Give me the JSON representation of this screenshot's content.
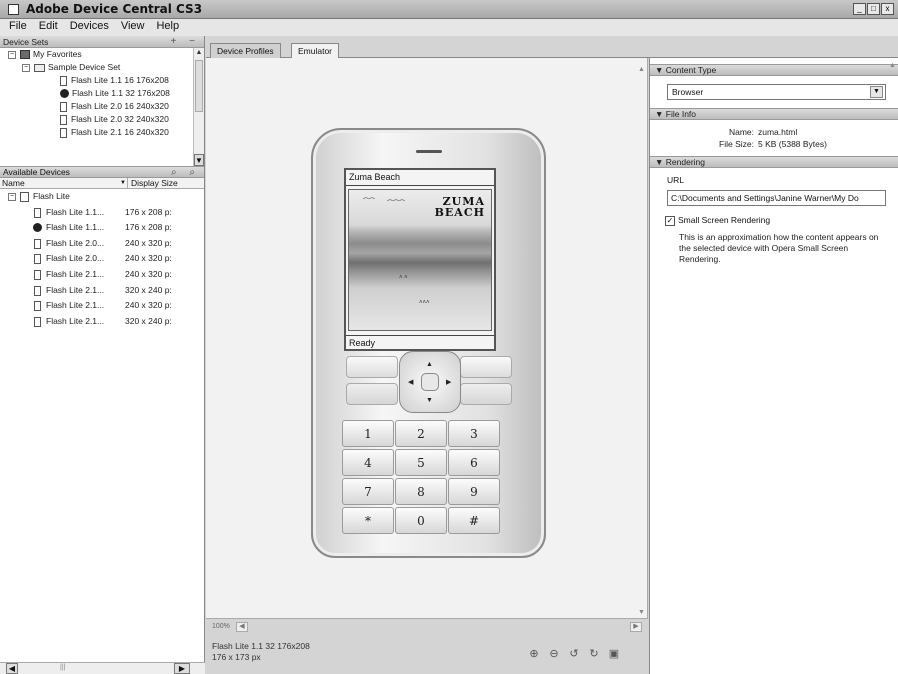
{
  "window": {
    "title": "Adobe Device Central CS3",
    "buttons": [
      "_",
      "□",
      "x"
    ]
  },
  "menu": [
    "File",
    "Edit",
    "Devices",
    "View",
    "Help"
  ],
  "device_sets": {
    "header": "Device Sets",
    "header_buttons": "+ −",
    "favorites": "My Favorites",
    "sample_set": "Sample Device Set",
    "items": [
      "Flash Lite 1.1 16 176x208",
      "Flash Lite 1.1 32 176x208",
      "Flash Lite 2.0 16 240x320",
      "Flash Lite 2.0 32 240x320",
      "Flash Lite 2.1 16 240x320"
    ]
  },
  "available_devices": {
    "header": "Available Devices",
    "col_name": "Name",
    "col_size": "Display Size",
    "group": "Flash Lite",
    "rows": [
      {
        "name": "Flash Lite 1.1...",
        "size": "176 x 208 p:"
      },
      {
        "name": "Flash Lite 1.1...",
        "size": "176 x 208 p:"
      },
      {
        "name": "Flash Lite 2.0...",
        "size": "240 x 320 p:"
      },
      {
        "name": "Flash Lite 2.0...",
        "size": "240 x 320 p:"
      },
      {
        "name": "Flash Lite 2.1...",
        "size": "240 x 320 p:"
      },
      {
        "name": "Flash Lite 2.1...",
        "size": "320 x 240 p:"
      },
      {
        "name": "Flash Lite 2.1...",
        "size": "240 x 320 p:"
      },
      {
        "name": "Flash Lite 2.1...",
        "size": "320 x 240 p:"
      }
    ]
  },
  "tabs": [
    "Device Profiles",
    "Emulator"
  ],
  "emulator": {
    "screen_title": "Zuma Beach",
    "logo_line1": "ZUMA",
    "logo_line2": "BEACH",
    "screen_status": "Ready",
    "keys": [
      "1",
      "2",
      "3",
      "4",
      "5",
      "6",
      "7",
      "8",
      "9",
      "*",
      "0",
      "#"
    ],
    "zoom": "100%",
    "status_device": "Flash Lite 1.1 32 176x208",
    "status_size": "176 x 173 px"
  },
  "content_type": {
    "header": "Content Type",
    "value": "Browser"
  },
  "file_info": {
    "header": "File Info",
    "name_label": "Name:",
    "name": "zuma.html",
    "size_label": "File Size:",
    "size": "5 KB (5388 Bytes)"
  },
  "rendering": {
    "header": "Rendering",
    "url_label": "URL",
    "url": "C:\\Documents and Settings\\Janine Warner\\My Do",
    "checkbox_label": "Small Screen Rendering",
    "checked": true,
    "note": "This is an approximation how the content appears on the selected device with Opera Small Screen Rendering."
  }
}
